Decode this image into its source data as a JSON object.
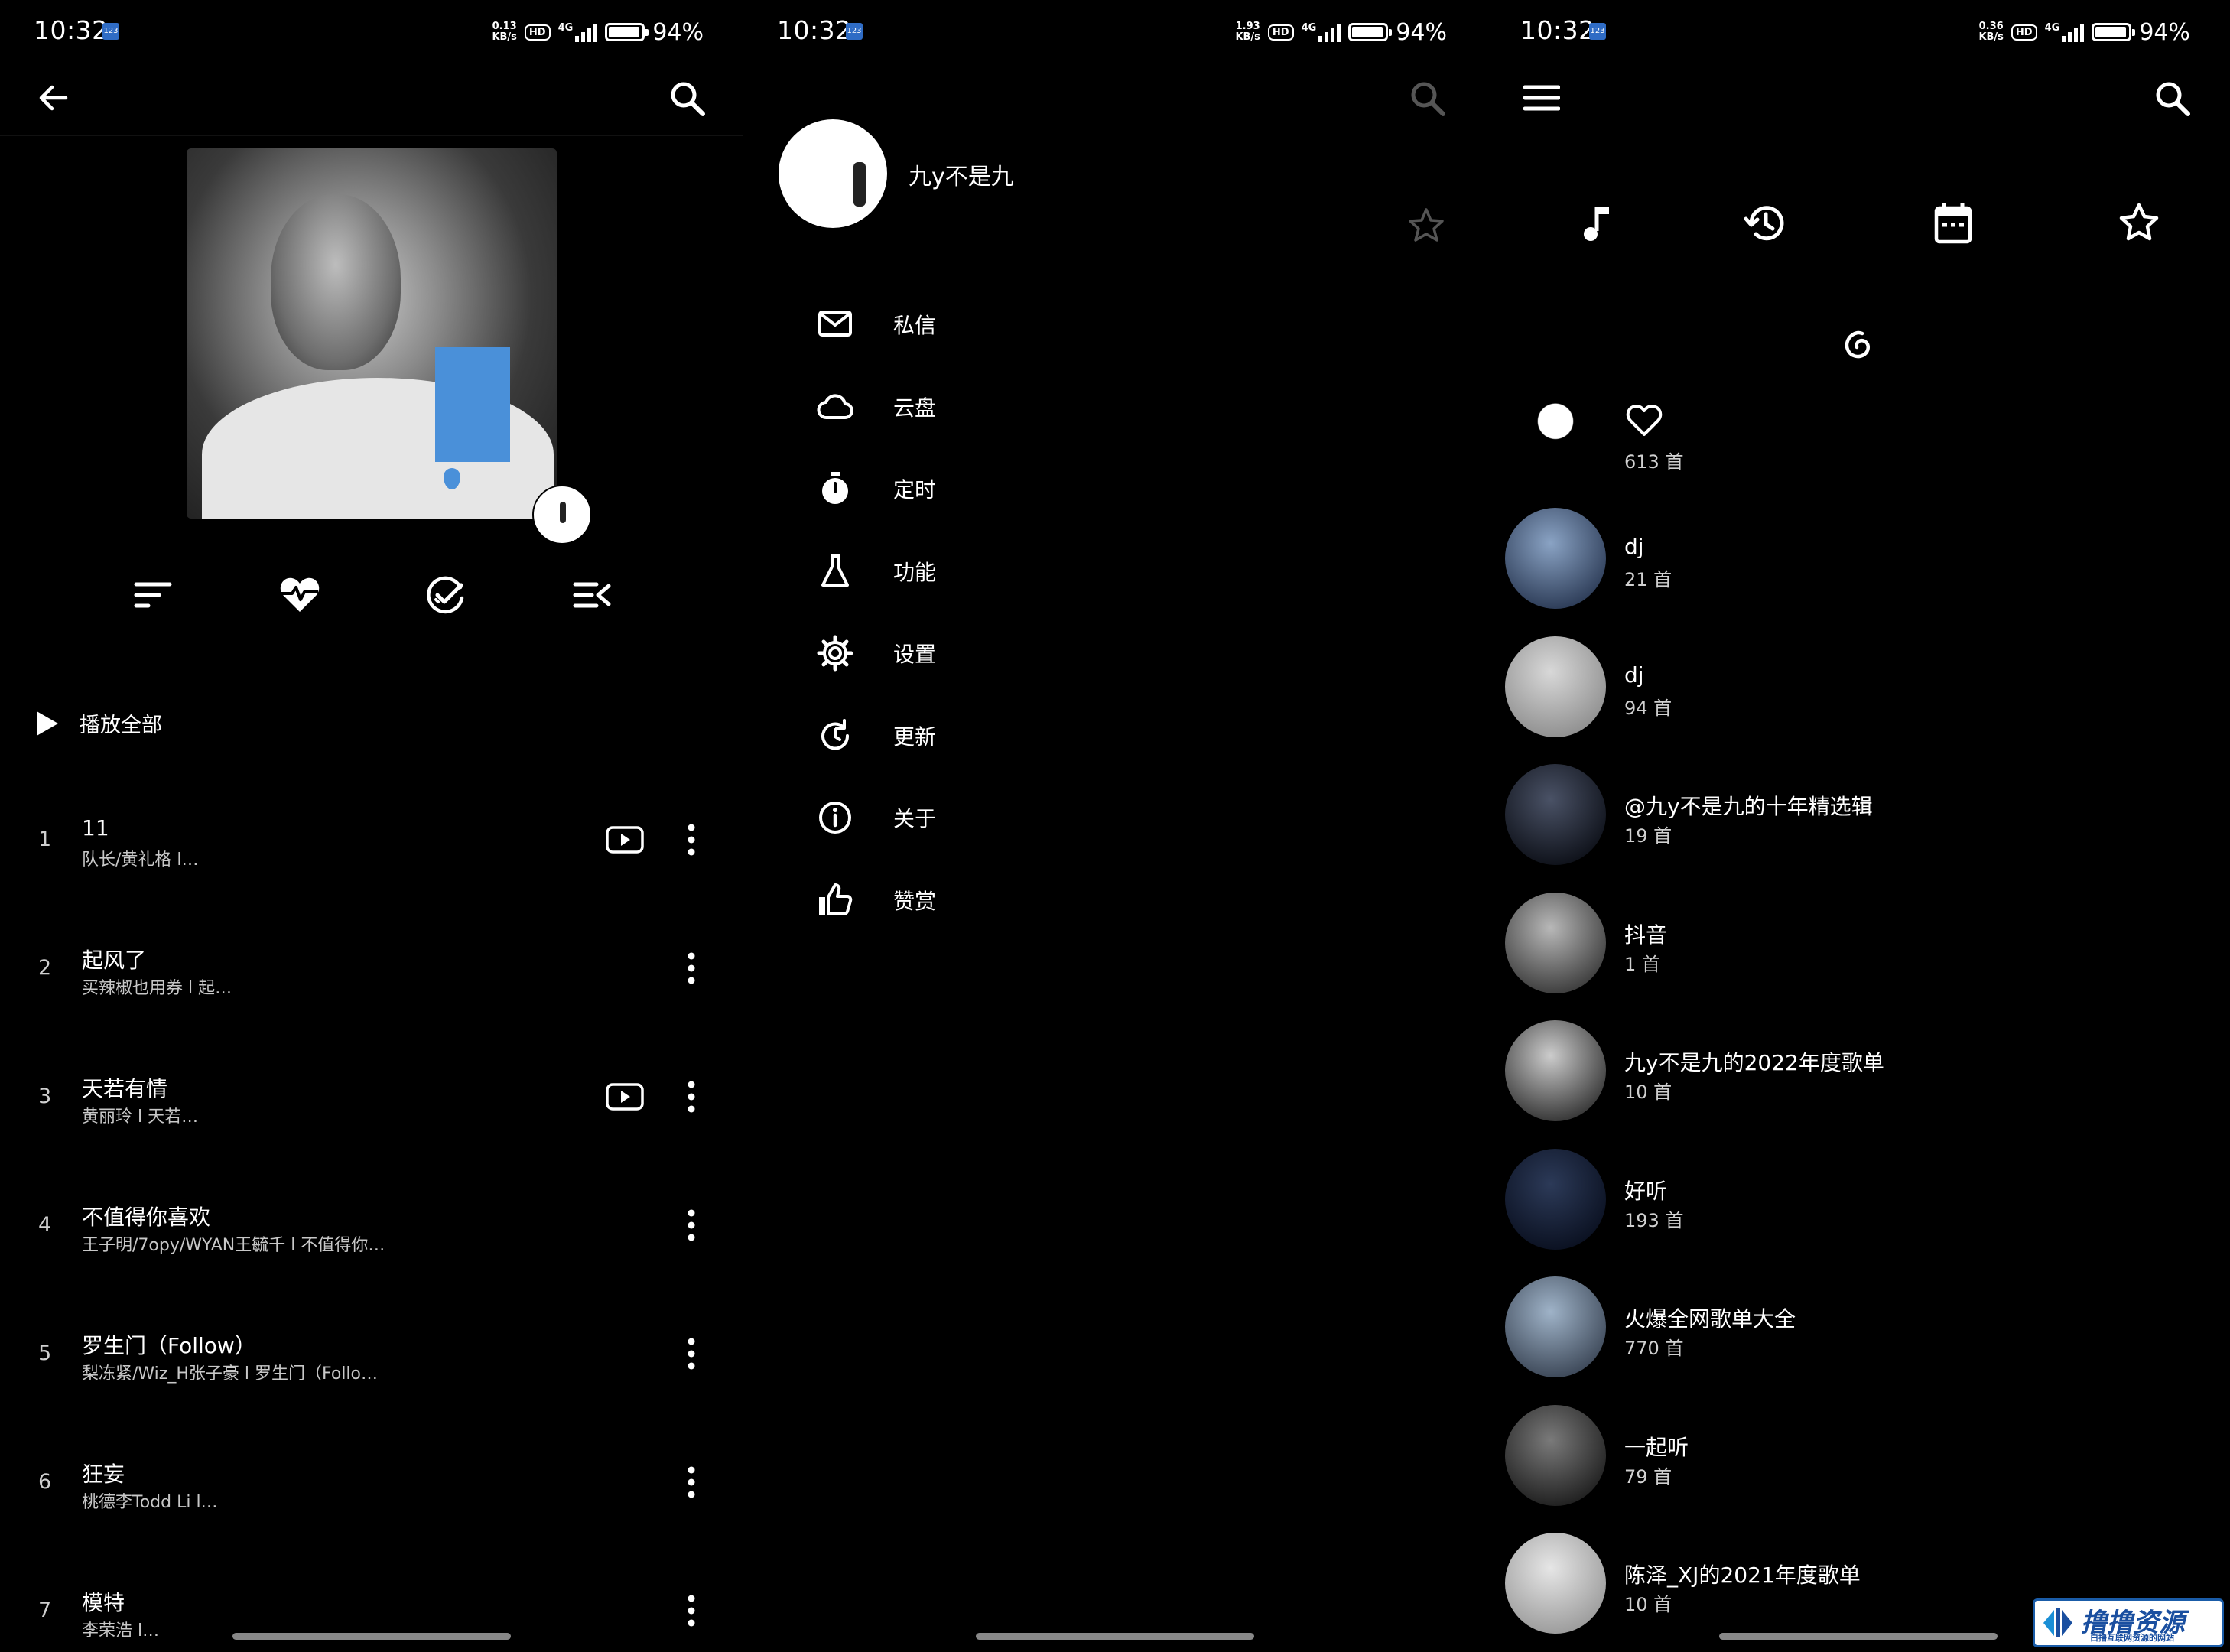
{
  "status_bars": [
    {
      "time": "10:32",
      "sim_badge": "123",
      "speed": "0.13\nKB/s",
      "hd": "HD",
      "network": "4G",
      "battery_level": 0.94,
      "battery": "94%"
    },
    {
      "time": "10:32",
      "sim_badge": "123",
      "speed": "1.93\nKB/s",
      "hd": "HD",
      "network": "4G",
      "battery_level": 0.94,
      "battery": "94%"
    },
    {
      "time": "10:32",
      "sim_badge": "123",
      "speed": "0.36\nKB/s",
      "hd": "HD",
      "network": "4G",
      "battery_level": 0.94,
      "battery": "94%"
    }
  ],
  "panel1": {
    "icons": {
      "back": "arrow-left-icon",
      "search": "search-icon"
    },
    "actions": [
      "sort-icon",
      "heartbeat-icon",
      "check-circle-icon",
      "queue-icon"
    ],
    "play_all": "播放全部",
    "songs": [
      {
        "num": "1",
        "title": "11",
        "sub": "队长/黄礼格 l…",
        "mv": true
      },
      {
        "num": "2",
        "title": "起风了",
        "sub": "买辣椒也用券 l  起…",
        "mv": false
      },
      {
        "num": "3",
        "title": "天若有情",
        "sub": "黄丽玲 l  天若…",
        "mv": true
      },
      {
        "num": "4",
        "title": "不值得你喜欢",
        "sub": "王子明/7opy/WYAN王毓千 l  不值得你…",
        "mv": false
      },
      {
        "num": "5",
        "title": "罗生门（Follow）",
        "sub": "梨冻紧/Wiz_H张子豪 l  罗生门（Follo…",
        "mv": false
      },
      {
        "num": "6",
        "title": "狂妄",
        "sub": "桃德李Todd Li l…",
        "mv": false
      },
      {
        "num": "7",
        "title": "模特",
        "sub": "李荣浩 l…",
        "mv": false
      }
    ]
  },
  "panel2": {
    "profile_name": "九y不是九",
    "menu": [
      {
        "icon": "mail-icon",
        "label": "私信"
      },
      {
        "icon": "cloud-icon",
        "label": "云盘"
      },
      {
        "icon": "timer-icon",
        "label": "定时"
      },
      {
        "icon": "flask-icon",
        "label": "功能"
      },
      {
        "icon": "gear-icon",
        "label": "设置"
      },
      {
        "icon": "update-icon",
        "label": "更新"
      },
      {
        "icon": "info-icon",
        "label": "关于"
      },
      {
        "icon": "thumbs-up-icon",
        "label": "赞赏"
      }
    ]
  },
  "panel3": {
    "tabs": [
      "music-note-icon",
      "history-icon",
      "calendar-icon",
      "star-icon"
    ],
    "liked": {
      "count": "613 首"
    },
    "playlists": [
      {
        "name": "dj",
        "count": "21 首",
        "colors": [
          "#8aa3c4",
          "#2b3a55"
        ]
      },
      {
        "name": "dj",
        "count": "94 首",
        "colors": [
          "#d8d8d8",
          "#8e8e8e"
        ]
      },
      {
        "name": "@九y不是九的十年精选辑",
        "count": "19 首",
        "colors": [
          "#4a5266",
          "#0d1018"
        ]
      },
      {
        "name": "抖音",
        "count": "1 首",
        "colors": [
          "#b8b8b8",
          "#3a3a3a"
        ]
      },
      {
        "name": "九y不是九的2022年度歌单",
        "count": "10 首",
        "colors": [
          "#cccccc",
          "#333333"
        ]
      },
      {
        "name": "好听",
        "count": "193 首",
        "colors": [
          "#2c3a58",
          "#0a1020"
        ]
      },
      {
        "name": "火爆全网歌单大全",
        "count": "770 首",
        "colors": [
          "#9fb3c8",
          "#3b4656"
        ]
      },
      {
        "name": "一起听",
        "count": "79 首",
        "colors": [
          "#7a7a7a",
          "#1e1e1e"
        ]
      },
      {
        "name": "陈泽_XJ的2021年度歌单",
        "count": "10 首",
        "colors": [
          "#e6e6e6",
          "#9a9a9a"
        ]
      }
    ]
  },
  "watermark": {
    "text": "撸撸资源",
    "sub": "白撸互联网资源的网站",
    "registered": "®"
  }
}
